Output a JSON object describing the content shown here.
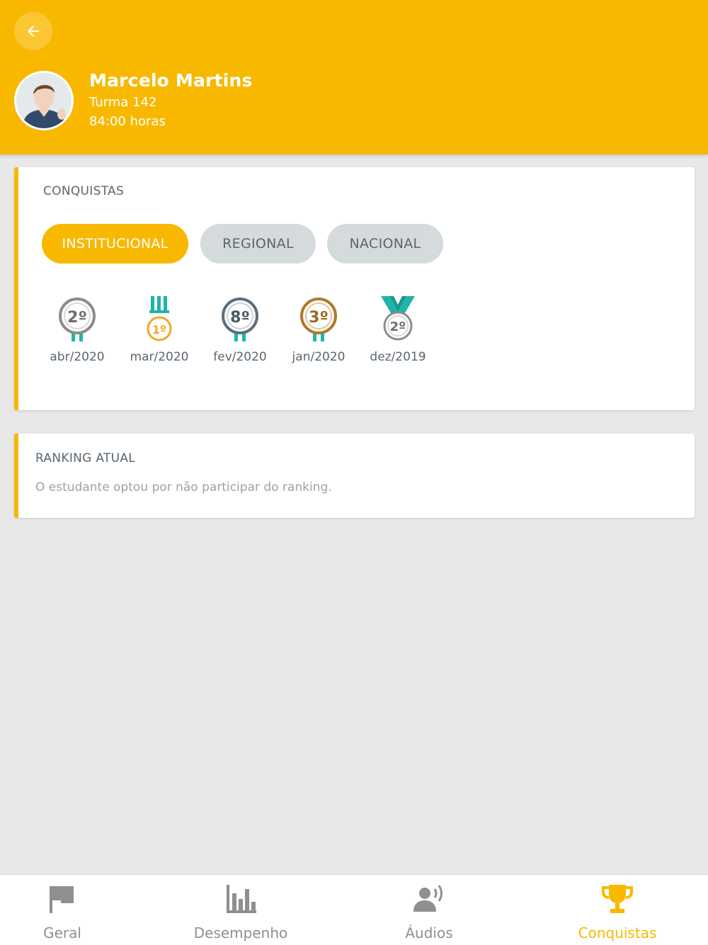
{
  "header": {
    "name": "Marcelo Martins",
    "class": "Turma 142",
    "hours": "84:00 horas",
    "colors": {
      "primary": "#f9b800"
    }
  },
  "conquistas": {
    "title": "CONQUISTAS",
    "filters": [
      {
        "label": "INSTITUCIONAL",
        "active": true
      },
      {
        "label": "REGIONAL",
        "active": false
      },
      {
        "label": "NACIONAL",
        "active": false
      }
    ],
    "medals": [
      {
        "place": "2º",
        "date": "abr/2020",
        "color": "#8c8c8c",
        "ribbon": "tabs"
      },
      {
        "place": "1º",
        "date": "mar/2020",
        "color": "#f5a623",
        "ribbon": "bars"
      },
      {
        "place": "8º",
        "date": "fev/2020",
        "color": "#5c6f7a",
        "ribbon": "tabs"
      },
      {
        "place": "3º",
        "date": "jan/2020",
        "color": "#b07a2a",
        "ribbon": "tabs"
      },
      {
        "place": "2º",
        "date": "dez/2019",
        "color": "#8c8c8c",
        "ribbon": "v"
      }
    ]
  },
  "ranking": {
    "title": "RANKING ATUAL",
    "message": "O estudante optou por não participar do ranking."
  },
  "nav": [
    {
      "label": "Geral",
      "icon": "flag-icon",
      "active": false
    },
    {
      "label": "Desempenho",
      "icon": "bar-chart-icon",
      "active": false
    },
    {
      "label": "Áudios",
      "icon": "speaking-person-icon",
      "active": false
    },
    {
      "label": "Conquistas",
      "icon": "trophy-icon",
      "active": true
    }
  ]
}
